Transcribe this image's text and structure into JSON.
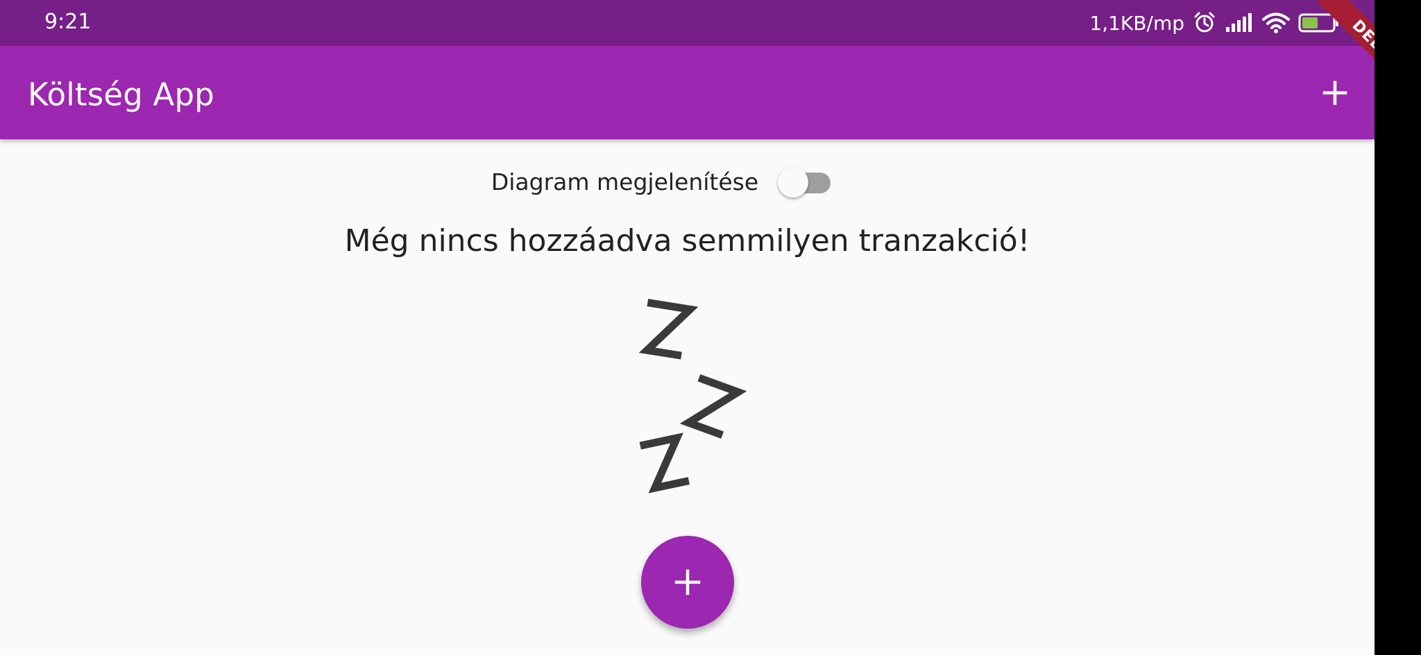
{
  "status_bar": {
    "time": "9:21",
    "net_speed": "1,1KB/mp",
    "icons": [
      "alarm-icon",
      "signal-icon",
      "wifi-icon",
      "battery-icon",
      "charging-icon"
    ],
    "battery_level": "50"
  },
  "debug_banner": {
    "label": "DEBUG"
  },
  "app_bar": {
    "title": "Költség App",
    "action_icon": "add-icon",
    "background": "#9c27b0"
  },
  "status_bar_color": "#761f86",
  "chart_toggle": {
    "label": "Diagram megjelenítése",
    "on": false
  },
  "empty_state": {
    "message": "Még nincs hozzáadva semmilyen tranzakció!",
    "image_icon": "sleeping-zzz-icon"
  },
  "fab": {
    "icon": "add-icon",
    "color": "#9c27b0"
  }
}
